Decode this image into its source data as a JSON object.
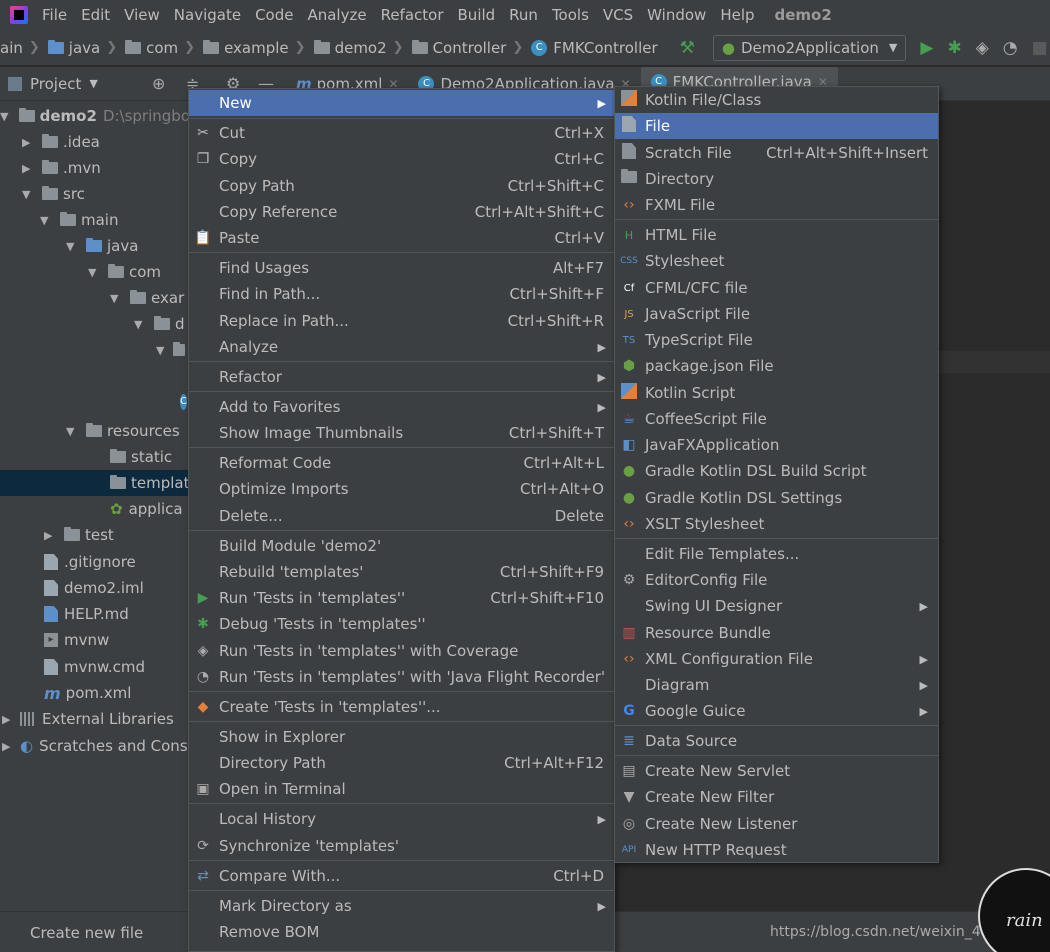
{
  "menubar": {
    "items": [
      "File",
      "Edit",
      "View",
      "Navigate",
      "Code",
      "Analyze",
      "Refactor",
      "Build",
      "Run",
      "Tools",
      "VCS",
      "Window",
      "Help"
    ],
    "project_name": "demo2"
  },
  "navbar": {
    "crumbs": [
      "ain",
      "java",
      "com",
      "example",
      "demo2",
      "Controller",
      "FMKController"
    ],
    "run_config": "Demo2Application"
  },
  "toolwindow": {
    "title": "Project"
  },
  "tabs": [
    {
      "label": "pom.xml",
      "icon": "m"
    },
    {
      "label": "Demo2Application.java",
      "icon": "c"
    },
    {
      "label": "FMKController.java",
      "icon": "c"
    }
  ],
  "tree": {
    "root_name": "demo2",
    "root_path": "D:\\springbo",
    "items": [
      {
        "label": ".idea",
        "type": "folder"
      },
      {
        "label": ".mvn",
        "type": "folder"
      },
      {
        "label": "src",
        "type": "folder"
      },
      {
        "label": "main",
        "type": "folder"
      },
      {
        "label": "java",
        "type": "folder-blue"
      },
      {
        "label": "com",
        "type": "package"
      },
      {
        "label": "exar",
        "type": "package"
      },
      {
        "label": "d",
        "type": "package"
      },
      {
        "label": "",
        "type": "package"
      },
      {
        "label": "",
        "type": "class"
      },
      {
        "label": "resources",
        "type": "folder-res"
      },
      {
        "label": "static",
        "type": "folder"
      },
      {
        "label": "templat",
        "type": "folder"
      },
      {
        "label": "applica",
        "type": "spring"
      },
      {
        "label": "test",
        "type": "folder"
      },
      {
        "label": ".gitignore",
        "type": "file"
      },
      {
        "label": "demo2.iml",
        "type": "file"
      },
      {
        "label": "HELP.md",
        "type": "md"
      },
      {
        "label": "mvnw",
        "type": "term"
      },
      {
        "label": "mvnw.cmd",
        "type": "file"
      },
      {
        "label": "pom.xml",
        "type": "maven"
      },
      {
        "label": "External Libraries",
        "type": "lib"
      },
      {
        "label": "Scratches and Cons",
        "type": "scratch"
      }
    ]
  },
  "context_menu": {
    "items": [
      {
        "label": "New",
        "shortcut": "",
        "sub": true,
        "icon": ""
      },
      {
        "label": "Cut",
        "shortcut": "Ctrl+X",
        "icon": "scissors-icon"
      },
      {
        "label": "Copy",
        "shortcut": "Ctrl+C",
        "icon": "copy-icon"
      },
      {
        "label": "Copy Path",
        "shortcut": "Ctrl+Shift+C"
      },
      {
        "label": "Copy Reference",
        "shortcut": "Ctrl+Alt+Shift+C"
      },
      {
        "label": "Paste",
        "shortcut": "Ctrl+V",
        "icon": "paste-icon"
      },
      {
        "label": "Find Usages",
        "shortcut": "Alt+F7"
      },
      {
        "label": "Find in Path...",
        "shortcut": "Ctrl+Shift+F"
      },
      {
        "label": "Replace in Path...",
        "shortcut": "Ctrl+Shift+R"
      },
      {
        "label": "Analyze",
        "shortcut": "",
        "sub": true
      },
      {
        "label": "Refactor",
        "shortcut": "",
        "sub": true
      },
      {
        "label": "Add to Favorites",
        "shortcut": "",
        "sub": true
      },
      {
        "label": "Show Image Thumbnails",
        "shortcut": "Ctrl+Shift+T"
      },
      {
        "label": "Reformat Code",
        "shortcut": "Ctrl+Alt+L"
      },
      {
        "label": "Optimize Imports",
        "shortcut": "Ctrl+Alt+O"
      },
      {
        "label": "Delete...",
        "shortcut": "Delete"
      },
      {
        "label": "Build Module 'demo2'",
        "shortcut": ""
      },
      {
        "label": "Rebuild 'templates'",
        "shortcut": "Ctrl+Shift+F9"
      },
      {
        "label": "Run 'Tests in 'templates''",
        "shortcut": "Ctrl+Shift+F10",
        "icon": "run-icon"
      },
      {
        "label": "Debug 'Tests in 'templates''",
        "shortcut": "",
        "icon": "debug-icon"
      },
      {
        "label": "Run 'Tests in 'templates'' with Coverage",
        "shortcut": "",
        "icon": "coverage-icon"
      },
      {
        "label": "Run 'Tests in 'templates'' with 'Java Flight Recorder'",
        "shortcut": "",
        "icon": "profiler-icon"
      },
      {
        "label": "Create 'Tests in 'templates''...",
        "shortcut": "",
        "icon": "create-test-icon"
      },
      {
        "label": "Show in Explorer",
        "shortcut": ""
      },
      {
        "label": "Directory Path",
        "shortcut": "Ctrl+Alt+F12"
      },
      {
        "label": "Open in Terminal",
        "shortcut": "",
        "icon": "terminal-icon"
      },
      {
        "label": "Local History",
        "shortcut": "",
        "sub": true
      },
      {
        "label": "Synchronize 'templates'",
        "shortcut": "",
        "icon": "sync-icon"
      },
      {
        "label": "Compare With...",
        "shortcut": "Ctrl+D",
        "icon": "compare-icon"
      },
      {
        "label": "Mark Directory as",
        "shortcut": "",
        "sub": true
      },
      {
        "label": "Remove BOM",
        "shortcut": ""
      }
    ]
  },
  "new_submenu": {
    "items": [
      {
        "label": "Kotlin File/Class",
        "shortcut": "",
        "icon": "kotlin-icon"
      },
      {
        "label": "File",
        "shortcut": "",
        "icon": "file-icon"
      },
      {
        "label": "Scratch File",
        "shortcut": "Ctrl+Alt+Shift+Insert",
        "icon": "scratch-file-icon"
      },
      {
        "label": "Directory",
        "shortcut": "",
        "icon": "folder-icon"
      },
      {
        "label": "FXML File",
        "shortcut": "",
        "icon": "fxml-icon"
      },
      {
        "label": "HTML File",
        "shortcut": "",
        "icon": "html-icon"
      },
      {
        "label": "Stylesheet",
        "shortcut": "",
        "icon": "css-icon"
      },
      {
        "label": "CFML/CFC file",
        "shortcut": "",
        "icon": "cfml-icon"
      },
      {
        "label": "JavaScript File",
        "shortcut": "",
        "icon": "js-icon"
      },
      {
        "label": "TypeScript File",
        "shortcut": "",
        "icon": "ts-icon"
      },
      {
        "label": "package.json File",
        "shortcut": "",
        "icon": "nodejs-icon"
      },
      {
        "label": "Kotlin Script",
        "shortcut": "",
        "icon": "kotlin-script-icon"
      },
      {
        "label": "CoffeeScript File",
        "shortcut": "",
        "icon": "coffee-icon"
      },
      {
        "label": "JavaFXApplication",
        "shortcut": "",
        "icon": "javafx-icon"
      },
      {
        "label": "Gradle Kotlin DSL Build Script",
        "shortcut": "",
        "icon": "gradle-icon"
      },
      {
        "label": "Gradle Kotlin DSL Settings",
        "shortcut": "",
        "icon": "gradle-icon"
      },
      {
        "label": "XSLT Stylesheet",
        "shortcut": "",
        "icon": "xslt-icon"
      },
      {
        "label": "Edit File Templates...",
        "shortcut": ""
      },
      {
        "label": "EditorConfig File",
        "shortcut": "",
        "icon": "gear-icon"
      },
      {
        "label": "Swing UI Designer",
        "shortcut": "",
        "sub": true
      },
      {
        "label": "Resource Bundle",
        "shortcut": "",
        "icon": "resource-bundle-icon"
      },
      {
        "label": "XML Configuration File",
        "shortcut": "",
        "sub": true,
        "icon": "xml-icon"
      },
      {
        "label": "Diagram",
        "shortcut": "",
        "sub": true
      },
      {
        "label": "Google Guice",
        "shortcut": "",
        "sub": true,
        "icon": "google-icon"
      },
      {
        "label": "Data Source",
        "shortcut": "",
        "icon": "database-icon"
      },
      {
        "label": "Create New Servlet",
        "shortcut": "",
        "icon": "servlet-icon"
      },
      {
        "label": "Create New Filter",
        "shortcut": "",
        "icon": "filter-icon"
      },
      {
        "label": "Create New Listener",
        "shortcut": "",
        "icon": "listener-icon"
      },
      {
        "label": "New HTTP Request",
        "shortcut": "",
        "icon": "api-icon"
      }
    ]
  },
  "status": {
    "text": "Create new file",
    "watermark": "https://blog.csdn.net/weixin_44500831",
    "badge_text": "rain"
  }
}
